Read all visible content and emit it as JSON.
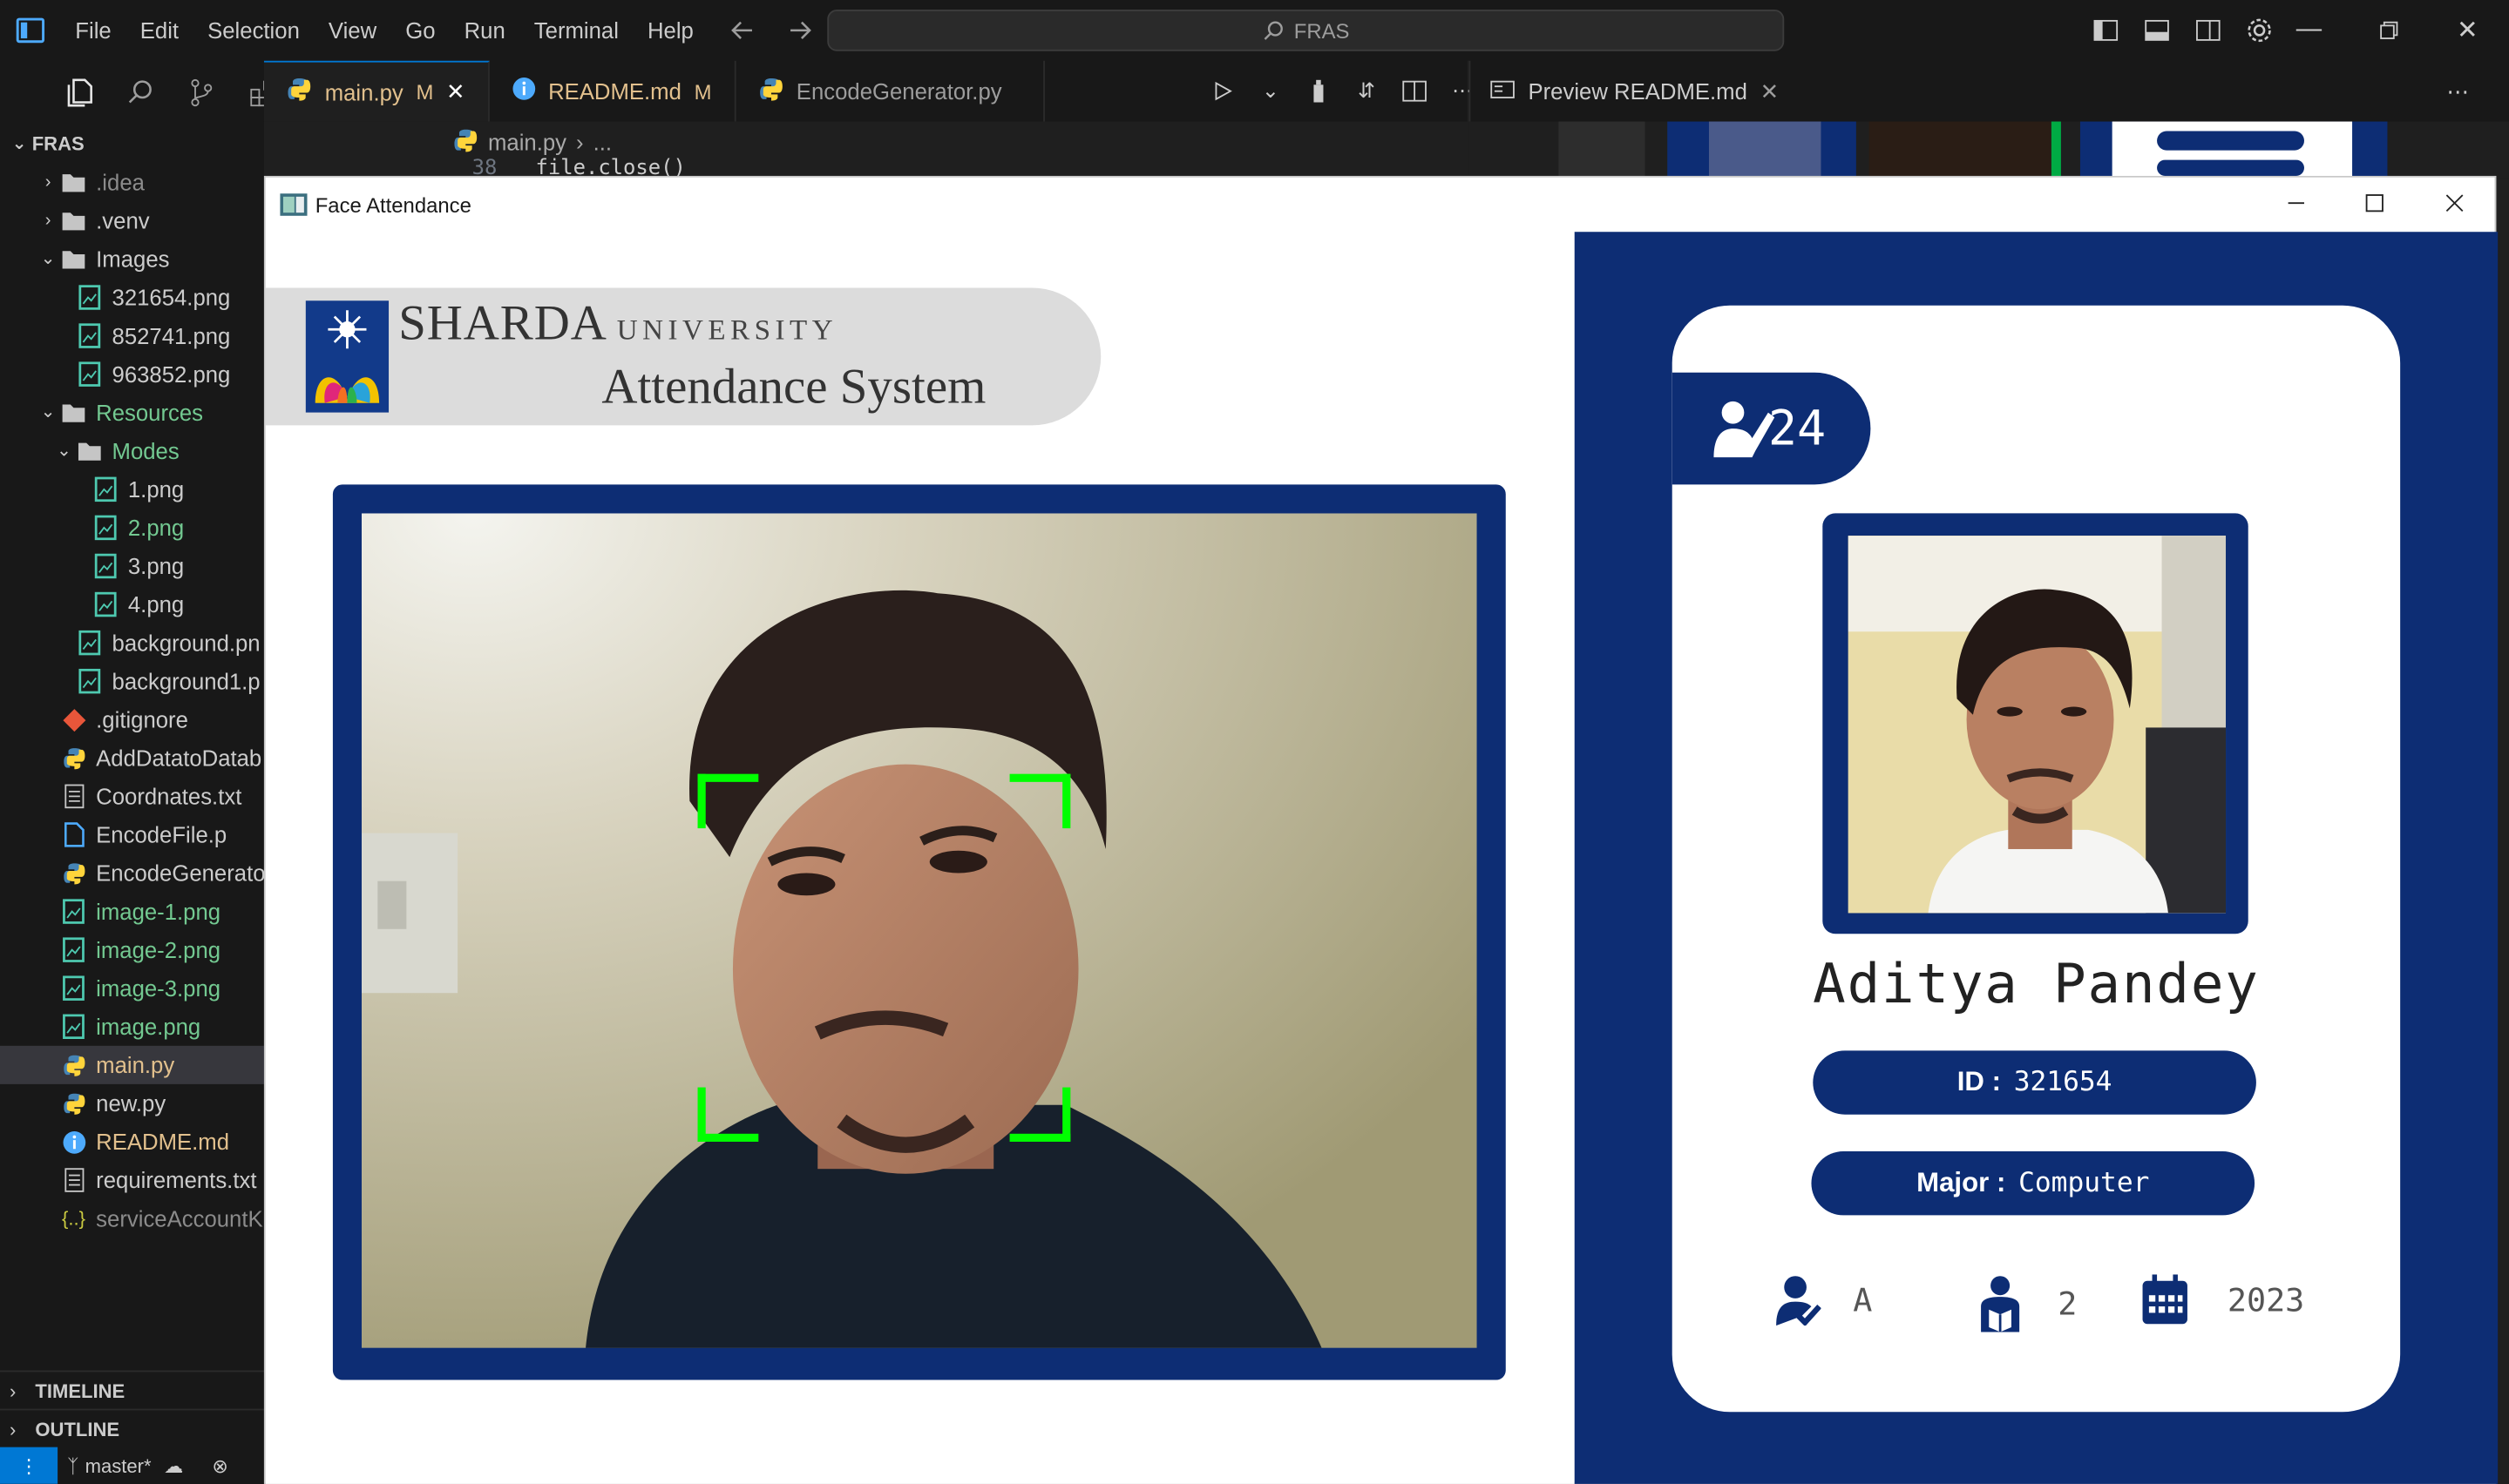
{
  "vscode": {
    "menu": [
      "File",
      "Edit",
      "Selection",
      "View",
      "Go",
      "Run",
      "Terminal",
      "Help"
    ],
    "search_text": "FRAS",
    "explorer_root": "FRAS",
    "tree": [
      {
        "label": ".idea",
        "depth": 1,
        "kind": "folder",
        "open": false,
        "color": "c-dim"
      },
      {
        "label": ".venv",
        "depth": 1,
        "kind": "folder",
        "open": false,
        "color": ""
      },
      {
        "label": "Images",
        "depth": 1,
        "kind": "folder",
        "open": true,
        "color": ""
      },
      {
        "label": "321654.png",
        "depth": 2,
        "kind": "image",
        "color": ""
      },
      {
        "label": "852741.png",
        "depth": 2,
        "kind": "image",
        "color": ""
      },
      {
        "label": "963852.png",
        "depth": 2,
        "kind": "image",
        "color": ""
      },
      {
        "label": "Resources",
        "depth": 1,
        "kind": "folder",
        "open": true,
        "color": "c-green"
      },
      {
        "label": "Modes",
        "depth": 2,
        "kind": "folder",
        "open": true,
        "color": "c-green"
      },
      {
        "label": "1.png",
        "depth": 3,
        "kind": "image",
        "color": ""
      },
      {
        "label": "2.png",
        "depth": 3,
        "kind": "image",
        "color": "c-green"
      },
      {
        "label": "3.png",
        "depth": 3,
        "kind": "image",
        "color": ""
      },
      {
        "label": "4.png",
        "depth": 3,
        "kind": "image",
        "color": ""
      },
      {
        "label": "background.pn",
        "depth": 2,
        "kind": "image",
        "color": ""
      },
      {
        "label": "background1.p",
        "depth": 2,
        "kind": "image",
        "color": ""
      },
      {
        "label": ".gitignore",
        "depth": 1,
        "kind": "git",
        "color": ""
      },
      {
        "label": "AddDatatoDatab",
        "depth": 1,
        "kind": "python",
        "color": ""
      },
      {
        "label": "Coordnates.txt",
        "depth": 1,
        "kind": "text",
        "color": ""
      },
      {
        "label": "EncodeFile.p",
        "depth": 1,
        "kind": "file",
        "color": ""
      },
      {
        "label": "EncodeGenerato",
        "depth": 1,
        "kind": "python",
        "color": ""
      },
      {
        "label": "image-1.png",
        "depth": 1,
        "kind": "image",
        "color": "c-green"
      },
      {
        "label": "image-2.png",
        "depth": 1,
        "kind": "image",
        "color": "c-green"
      },
      {
        "label": "image-3.png",
        "depth": 1,
        "kind": "image",
        "color": "c-green"
      },
      {
        "label": "image.png",
        "depth": 1,
        "kind": "image",
        "color": "c-green"
      },
      {
        "label": "main.py",
        "depth": 1,
        "kind": "python",
        "color": "c-yellow",
        "selected": true
      },
      {
        "label": "new.py",
        "depth": 1,
        "kind": "python",
        "color": ""
      },
      {
        "label": "README.md",
        "depth": 1,
        "kind": "info",
        "color": "c-yellow"
      },
      {
        "label": "requirements.txt",
        "depth": 1,
        "kind": "text",
        "color": ""
      },
      {
        "label": "serviceAccountK",
        "depth": 1,
        "kind": "json",
        "color": "c-dim"
      }
    ],
    "timeline_label": "TIMELINE",
    "outline_label": "OUTLINE",
    "branch": "master*",
    "tabs": {
      "main": {
        "label": "main.py",
        "mod": "M"
      },
      "readme": {
        "label": "README.md",
        "mod": "M"
      },
      "encode": {
        "label": "EncodeGenerator.py"
      }
    },
    "breadcrumb_file": "main.py",
    "breadcrumb_more": "...",
    "code_line_number": "38",
    "code_line_text": "file.close()",
    "preview_tab": "Preview README.md"
  },
  "face_app": {
    "window_title": "Face Attendance",
    "university": "SHARDA",
    "university_suffix": "UNIVERSITY",
    "system_title": "Attendance System",
    "attendance_count": "24",
    "student_name": "Aditya Pandey",
    "id_label": "ID :",
    "id_value": "321654",
    "major_label": "Major :",
    "major_value": "Computer",
    "standing": "A",
    "year": "2",
    "starting_year": "2023",
    "colors": {
      "primary": "#0d2d74",
      "detection_box": "#00ff00"
    }
  }
}
